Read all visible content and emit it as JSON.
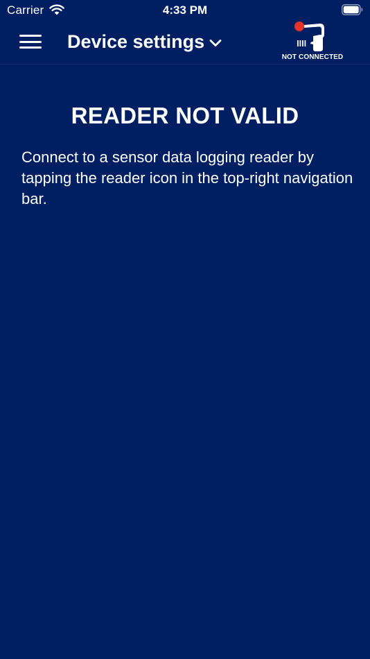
{
  "status_bar": {
    "carrier": "Carrier",
    "time": "4:33 PM",
    "wifi_icon": "wifi-icon",
    "battery_icon": "battery-full-icon"
  },
  "nav": {
    "title": "Device settings",
    "menu_icon": "hamburger-menu-icon",
    "title_chevron_icon": "chevron-down-icon",
    "reader_icon": "barcode-reader-icon",
    "reader_status": "NOT CONNECTED",
    "reader_status_dot_color": "#e8332a"
  },
  "main": {
    "heading": "READER NOT VALID",
    "message": "Connect to a sensor data logging reader by tapping the reader icon in the top-right navigation bar."
  },
  "colors": {
    "background": "#001f62",
    "text": "#ffffff"
  }
}
